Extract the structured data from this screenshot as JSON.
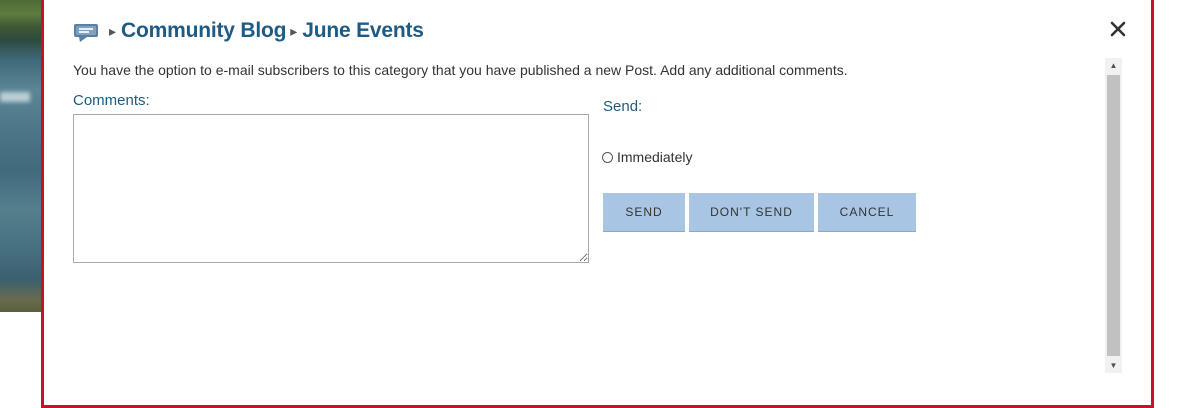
{
  "header": {
    "breadcrumb_separator": "▸",
    "crumb_1": "Community Blog",
    "crumb_2": "June Events"
  },
  "dialog": {
    "intro_text": "You have the option to e-mail subscribers to this category that you have published a new Post. Add any additional comments.",
    "comments_label": "Comments:",
    "comments_value": "",
    "send_label": "Send:",
    "send_option": "Immediately"
  },
  "buttons": {
    "send": "SEND",
    "dont_send": "DON'T SEND",
    "cancel": "CANCEL",
    "close": "✕"
  },
  "colors": {
    "dialog_border": "#c8102e",
    "heading": "#1d5b85",
    "button_bg": "#a8c6e4"
  }
}
